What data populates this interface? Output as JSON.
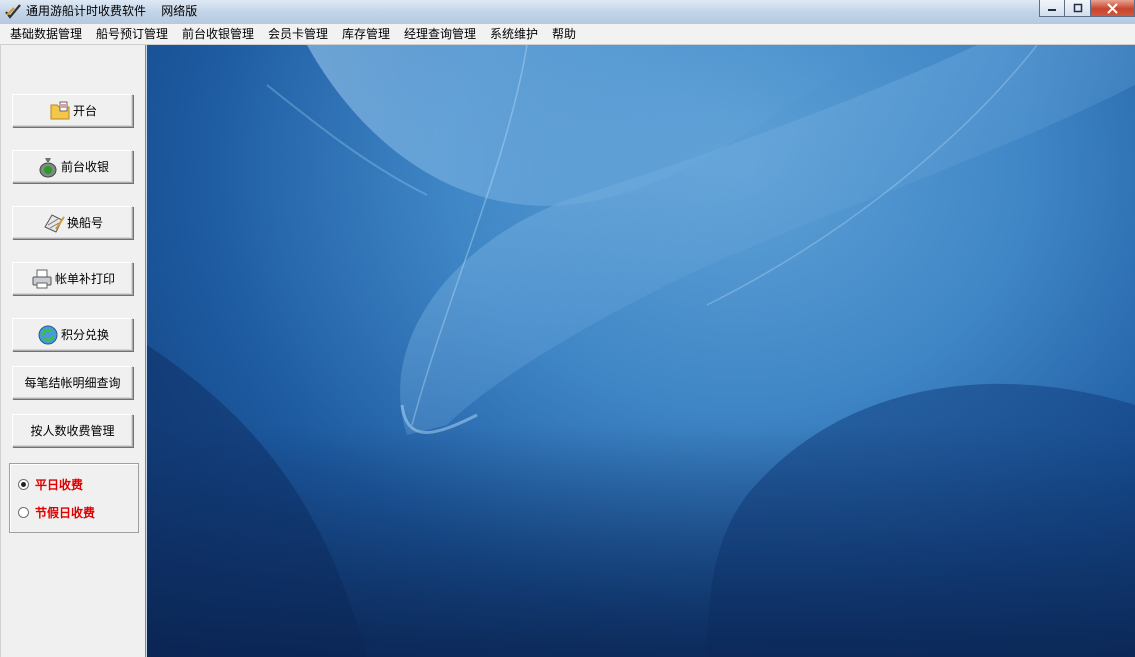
{
  "window": {
    "title": "通用游船计时收费软件    网络版",
    "minimize_icon": "minimize-icon",
    "maximize_icon": "maximize-icon",
    "close_icon": "close-icon"
  },
  "menu": [
    "基础数据管理",
    "船号预订管理",
    "前台收银管理",
    "会员卡管理",
    "库存管理",
    "经理查询管理",
    "系统维护",
    "帮助"
  ],
  "sidebar": {
    "buttons": [
      {
        "label": "开台",
        "icon": "open-table-icon"
      },
      {
        "label": "前台收银",
        "icon": "money-bag-icon"
      },
      {
        "label": "换船号",
        "icon": "change-boat-icon"
      },
      {
        "label": "帐单补打印",
        "icon": "printer-icon"
      },
      {
        "label": "积分兑换",
        "icon": "points-exchange-icon"
      },
      {
        "label": "每笔结帐明细查询",
        "icon": ""
      },
      {
        "label": "按人数收费管理",
        "icon": ""
      }
    ],
    "charge_mode": {
      "options": [
        "平日收费",
        "节假日收费"
      ],
      "selected": "平日收费"
    }
  },
  "colors": {
    "accent_red": "#e00000",
    "desktop_blue": "#3f86c6"
  }
}
